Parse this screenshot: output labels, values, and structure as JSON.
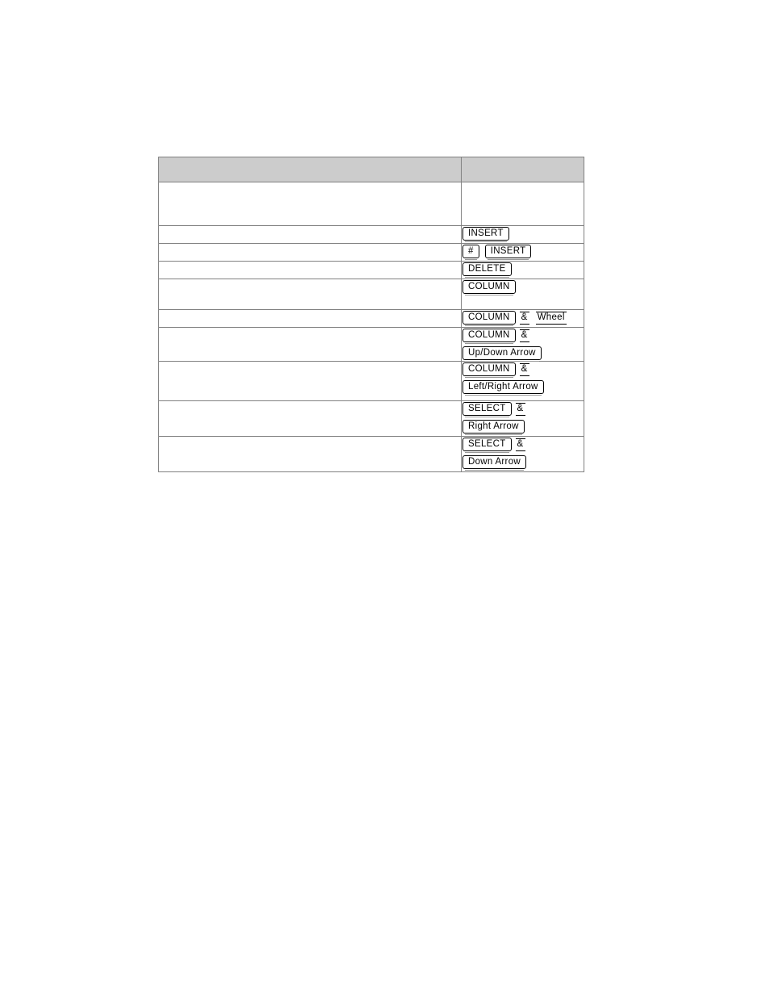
{
  "document": {
    "page_background": "#ffffff",
    "table": {
      "header_fill": "#cccccc",
      "border_color": "#808080",
      "columns": [
        {
          "id": "action",
          "header": ""
        },
        {
          "id": "keys",
          "header": ""
        }
      ],
      "rows": [
        {
          "action": "",
          "keys": [
            {
              "items": []
            }
          ]
        },
        {
          "action": "",
          "keys": [
            {
              "items": [
                {
                  "type": "key",
                  "label": "INSERT"
                }
              ]
            }
          ]
        },
        {
          "action": "",
          "keys": [
            {
              "items": [
                {
                  "type": "key",
                  "label": "#"
                },
                {
                  "type": "gap"
                },
                {
                  "type": "key",
                  "label": "INSERT"
                }
              ]
            }
          ]
        },
        {
          "action": "",
          "keys": [
            {
              "items": [
                {
                  "type": "key",
                  "label": "DELETE"
                }
              ]
            }
          ]
        },
        {
          "action": "",
          "keys": [
            {
              "items": [
                {
                  "type": "key",
                  "label": "COLUMN"
                }
              ]
            }
          ]
        },
        {
          "action": "",
          "keys": [
            {
              "items": [
                {
                  "type": "key",
                  "label": "COLUMN"
                },
                {
                  "type": "rule",
                  "label": "&"
                },
                {
                  "type": "rule",
                  "label": "Wheel"
                }
              ]
            }
          ]
        },
        {
          "action": "",
          "keys": [
            {
              "items": [
                {
                  "type": "key",
                  "label": "COLUMN"
                },
                {
                  "type": "rule",
                  "label": "&"
                }
              ]
            },
            {
              "items": [
                {
                  "type": "key",
                  "label": "Up/Down Arrow"
                }
              ]
            }
          ]
        },
        {
          "action": "",
          "keys": [
            {
              "items": [
                {
                  "type": "key",
                  "label": "COLUMN"
                },
                {
                  "type": "rule",
                  "label": "&"
                }
              ]
            },
            {
              "items": [
                {
                  "type": "key",
                  "label": "Left/Right Arrow"
                }
              ]
            }
          ]
        },
        {
          "action": "",
          "keys": [
            {
              "items": [
                {
                  "type": "key",
                  "label": "SELECT"
                },
                {
                  "type": "rule",
                  "label": "&"
                }
              ]
            },
            {
              "items": [
                {
                  "type": "key",
                  "label": "Right  Arrow"
                }
              ]
            }
          ]
        },
        {
          "action": "",
          "keys": [
            {
              "items": [
                {
                  "type": "key",
                  "label": "SELECT"
                },
                {
                  "type": "rule",
                  "label": "&"
                }
              ]
            },
            {
              "items": [
                {
                  "type": "key",
                  "label": "Down Arrow"
                }
              ]
            }
          ]
        }
      ]
    }
  }
}
